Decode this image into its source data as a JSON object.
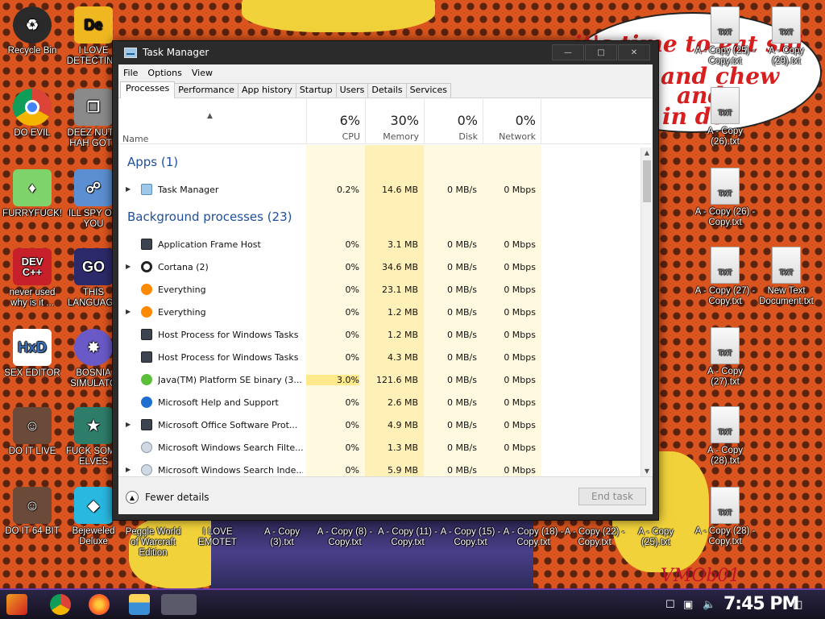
{
  "window": {
    "title": "Task Manager",
    "controls": {
      "minimize": "—",
      "maximize": "□",
      "close": "✕"
    }
  },
  "menu": [
    "File",
    "Options",
    "View"
  ],
  "tabs": [
    "Processes",
    "Performance",
    "App history",
    "Startup",
    "Users",
    "Details",
    "Services"
  ],
  "active_tab": "Processes",
  "columns": {
    "name": "Name",
    "cpu": {
      "pct": "6%",
      "label": "CPU"
    },
    "memory": {
      "pct": "30%",
      "label": "Memory"
    },
    "disk": {
      "pct": "0%",
      "label": "Disk"
    },
    "network": {
      "pct": "0%",
      "label": "Network"
    }
  },
  "groups": {
    "apps": "Apps (1)",
    "background": "Background processes (23)"
  },
  "apps": [
    {
      "name": "Task Manager",
      "cpu": "0.2%",
      "memory": "14.6 MB",
      "disk": "0 MB/s",
      "network": "0 Mbps",
      "icon": "task-manager-icon",
      "expandable": true
    }
  ],
  "background": [
    {
      "name": "Application Frame Host",
      "cpu": "0%",
      "memory": "3.1 MB",
      "disk": "0 MB/s",
      "network": "0 Mbps",
      "icon": "window-icon",
      "expandable": false
    },
    {
      "name": "Cortana (2)",
      "cpu": "0%",
      "memory": "34.6 MB",
      "disk": "0 MB/s",
      "network": "0 Mbps",
      "icon": "cortana-icon",
      "expandable": true
    },
    {
      "name": "Everything",
      "cpu": "0%",
      "memory": "23.1 MB",
      "disk": "0 MB/s",
      "network": "0 Mbps",
      "icon": "magnifier-icon",
      "expandable": false
    },
    {
      "name": "Everything",
      "cpu": "0%",
      "memory": "1.2 MB",
      "disk": "0 MB/s",
      "network": "0 Mbps",
      "icon": "magnifier-icon",
      "expandable": true
    },
    {
      "name": "Host Process for Windows Tasks",
      "cpu": "0%",
      "memory": "1.2 MB",
      "disk": "0 MB/s",
      "network": "0 Mbps",
      "icon": "window-icon",
      "expandable": false
    },
    {
      "name": "Host Process for Windows Tasks",
      "cpu": "0%",
      "memory": "4.3 MB",
      "disk": "0 MB/s",
      "network": "0 Mbps",
      "icon": "window-icon",
      "expandable": false
    },
    {
      "name": "Java(TM) Platform SE binary (3...",
      "cpu": "3.0%",
      "memory": "121.6 MB",
      "disk": "0 MB/s",
      "network": "0 Mbps",
      "icon": "java-icon",
      "expandable": false
    },
    {
      "name": "Microsoft Help and Support",
      "cpu": "0%",
      "memory": "2.6 MB",
      "disk": "0 MB/s",
      "network": "0 Mbps",
      "icon": "help-icon",
      "expandable": false
    },
    {
      "name": "Microsoft Office Software Prot...",
      "cpu": "0%",
      "memory": "4.9 MB",
      "disk": "0 MB/s",
      "network": "0 Mbps",
      "icon": "window-icon",
      "expandable": true
    },
    {
      "name": "Microsoft Windows Search Filte...",
      "cpu": "0%",
      "memory": "1.3 MB",
      "disk": "0 MB/s",
      "network": "0 Mbps",
      "icon": "search-user-icon",
      "expandable": false
    },
    {
      "name": "Microsoft Windows Search Inde...",
      "cpu": "0%",
      "memory": "5.9 MB",
      "disk": "0 MB/s",
      "network": "0 Mbps",
      "icon": "search-user-icon",
      "expandable": true
    }
  ],
  "footer": {
    "fewer_details": "Fewer details",
    "end_task": "End task"
  },
  "desktop_icons": [
    {
      "label": "Recycle Bin",
      "icon": "recycle-bin-icon",
      "color": "#2a2a2a"
    },
    {
      "label": "I LOVE DETECTING",
      "icon": "de-icon",
      "color": "#f0b820"
    },
    {
      "label": "DO EVIL",
      "icon": "chrome-icon",
      "color": "#1a73e8"
    },
    {
      "label": "DEEZ NUTS HAH GOTT",
      "icon": "windows-stack-icon",
      "color": "#888888"
    },
    {
      "label": "FURRYFUCK!",
      "icon": "gem-character-icon",
      "color": "#7fd36b"
    },
    {
      "label": "ILL SPY ON YOU",
      "icon": "network-icon",
      "color": "#5b8fd1"
    },
    {
      "label": "never used why is it ...",
      "icon": "dev-cpp-icon",
      "color": "#c8202a"
    },
    {
      "label": "THIS LANGUAGE",
      "icon": "goland-icon",
      "color": "#2d2a6b"
    },
    {
      "label": "SEX EDITOR",
      "icon": "hxd-icon",
      "color": "#3b6fb6"
    },
    {
      "label": "BOSNIA SIMULATO",
      "icon": "mine-icon",
      "color": "#6a5ac8"
    },
    {
      "label": "DO IT LIVE",
      "icon": "portrait-icon",
      "color": "#6b4a3a"
    },
    {
      "label": "FUCK SOME ELVES",
      "icon": "elf-game-icon",
      "color": "#2e7d6a"
    },
    {
      "label": "DO IT 64 BIT",
      "icon": "portrait-icon",
      "color": "#6b4a3a"
    },
    {
      "label": "Bejeweled Deluxe",
      "icon": "diamond-icon",
      "color": "#28b8e0"
    }
  ],
  "bottom_icons": [
    "Peggle World of Warcraft Edition",
    "I LOVE EMOTET",
    "A - Copy (3).txt",
    "A - Copy (8) - Copy.txt",
    "A - Copy (11) - Copy.txt",
    "A - Copy (15) - Copy.txt",
    "A - Copy (18) - Copy.txt",
    "A - Copy (22) - Copy.txt",
    "A - Copy (25).txt",
    "A - Copy (28) - Copy.txt"
  ],
  "right_icons": [
    {
      "label": "A - Copy (25) - Copy.txt"
    },
    {
      "label": "A - Copy (29).txt"
    },
    {
      "label": "A - Copy (26).txt"
    },
    {
      "label": "A - Copy (26) - Copy.txt"
    },
    {
      "label": "A - Copy (27) - Copy.txt"
    },
    {
      "label": "New Text Document.txt"
    },
    {
      "label": "A - Copy (27).txt"
    },
    {
      "label": "A - Copy (28).txt"
    }
  ],
  "txt_caption": "TXT",
  "bubble": {
    "line1": "it's time to eat shi",
    "line2": "and chew",
    "line3": "and",
    "line4": "in de"
  },
  "signature": "VMOb01",
  "taskbar": {
    "clock": "7:45 PM"
  },
  "colors": {
    "title_bar": "#2b2b2b",
    "group_header": "#1f4e9c",
    "heat_light": "#fff9e0",
    "heat_mid": "#fff0b8",
    "heat_strong": "#ffe98a"
  }
}
